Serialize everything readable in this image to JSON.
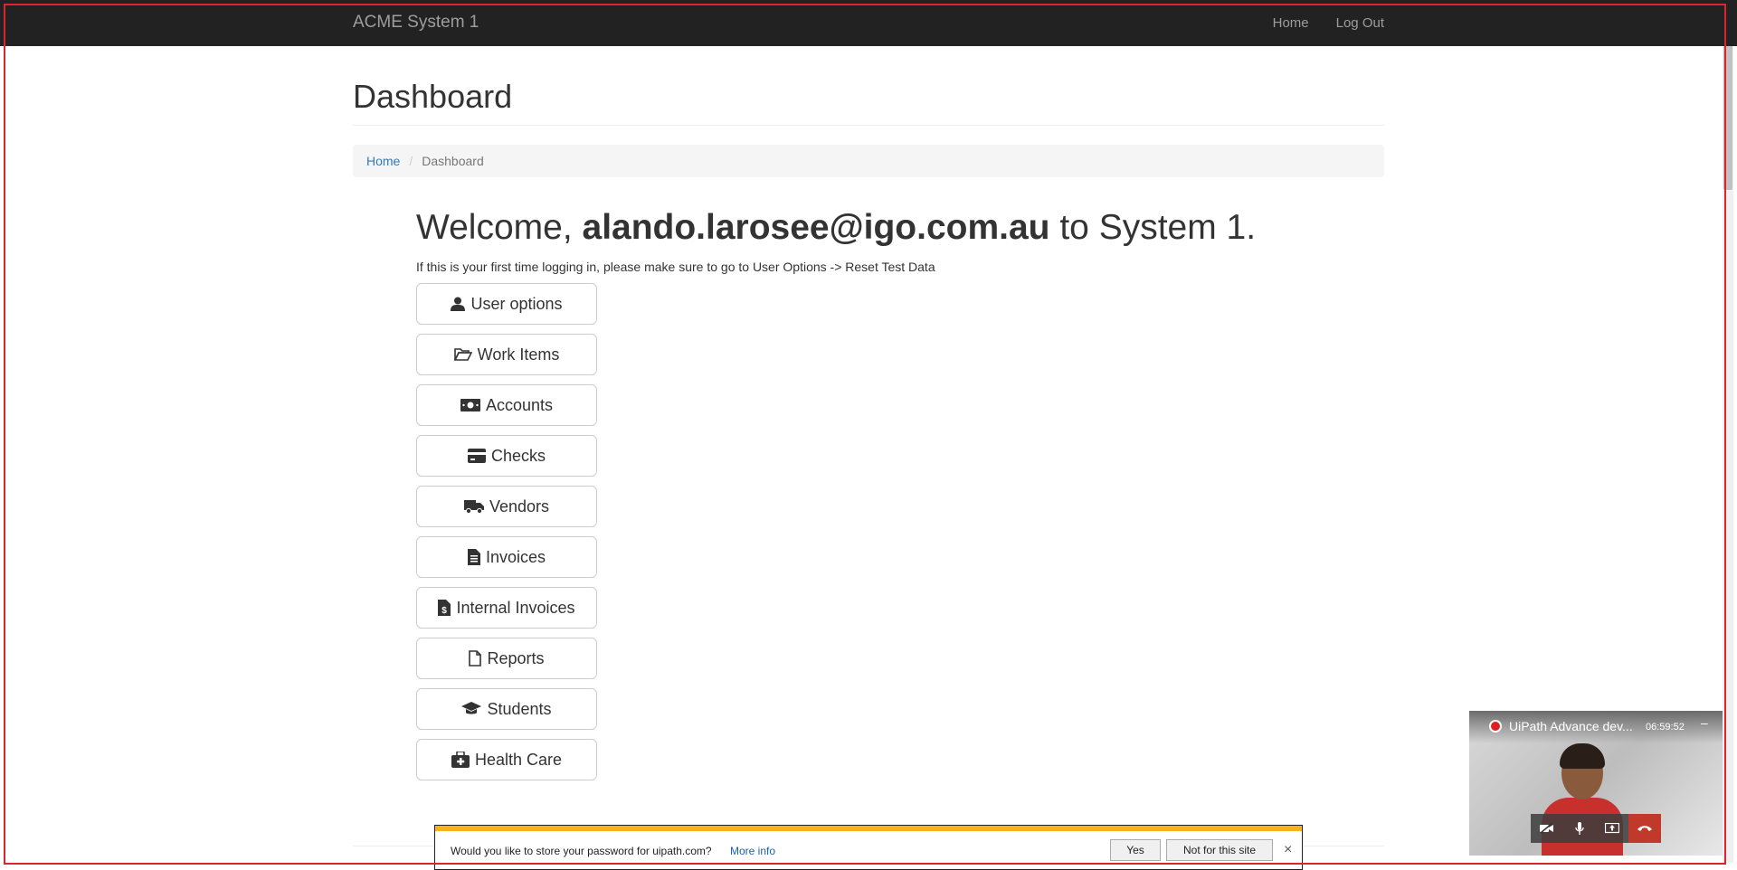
{
  "navbar": {
    "brand": "ACME System 1",
    "links": {
      "home": "Home",
      "logout": "Log Out"
    }
  },
  "page": {
    "title": "Dashboard"
  },
  "breadcrumb": {
    "home": "Home",
    "separator": "/",
    "current": "Dashboard"
  },
  "welcome": {
    "prefix": "Welcome, ",
    "user": "alando.larosee@igo.com.au",
    "suffix": " to System 1."
  },
  "hint": "If this is your first time logging in, please make sure to go to User Options -> Reset Test Data",
  "menu": [
    {
      "label": "User options",
      "icon": "user-icon"
    },
    {
      "label": "Work Items",
      "icon": "folder-open-icon"
    },
    {
      "label": "Accounts",
      "icon": "money-icon"
    },
    {
      "label": "Checks",
      "icon": "credit-card-icon"
    },
    {
      "label": "Vendors",
      "icon": "truck-icon"
    },
    {
      "label": "Invoices",
      "icon": "invoice-file-icon"
    },
    {
      "label": "Internal Invoices",
      "icon": "dollar-file-icon"
    },
    {
      "label": "Reports",
      "icon": "file-icon"
    },
    {
      "label": "Students",
      "icon": "graduation-cap-icon"
    },
    {
      "label": "Health Care",
      "icon": "medkit-icon"
    }
  ],
  "password_prompt": {
    "question": "Would you like to store your password for uipath.com?",
    "more_info": "More info",
    "yes": "Yes",
    "no": "Not for this site",
    "close": "×"
  },
  "call": {
    "title": "UiPath Advance dev...",
    "timer": "06:59:52",
    "minimize": "–"
  },
  "colors": {
    "navbar": "#222222",
    "link": "#337ab7",
    "accent_stripe": "#f7b21b",
    "frame": "#d9252b"
  }
}
